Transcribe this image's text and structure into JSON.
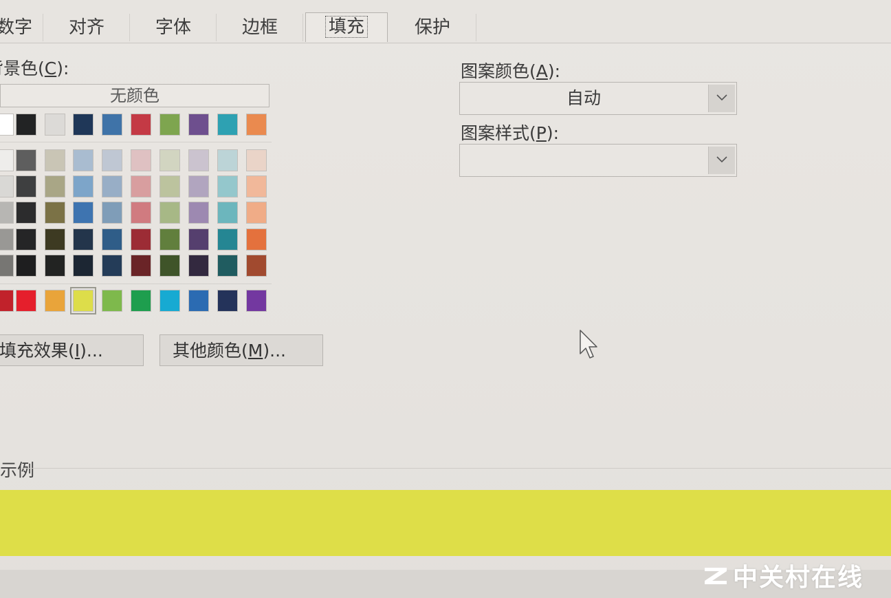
{
  "tabs": [
    {
      "label": "数字"
    },
    {
      "label": "对齐"
    },
    {
      "label": "字体"
    },
    {
      "label": "边框"
    },
    {
      "label": "填充",
      "active": true
    },
    {
      "label": "保护"
    }
  ],
  "background_color": {
    "label_text": "背景色",
    "hotkey": "C",
    "no_color_label": "无颜色"
  },
  "palette": {
    "theme_top_row": [
      "#ffffff",
      "#222324",
      "#dcdad7",
      "#1f3758",
      "#3f73a8",
      "#c43a45",
      "#7ea54f",
      "#6e4f8e",
      "#2ea1b2",
      "#ea8a4f"
    ],
    "theme_tints": [
      [
        "#eeedeb",
        "#5e5e5e",
        "#c9c5b5",
        "#a9bcd0",
        "#bfc7d3",
        "#dfc1c2",
        "#d2d5c1",
        "#cbc3cf",
        "#bcd4d7",
        "#ead4c8"
      ],
      [
        "#d9d8d5",
        "#3e3f40",
        "#a9a686",
        "#7da5c9",
        "#98aec6",
        "#d89e9f",
        "#bcc39e",
        "#b1a5bf",
        "#94c7cc",
        "#f1b89a"
      ],
      [
        "#b7b6b3",
        "#2c2c2d",
        "#7b7246",
        "#3e74b0",
        "#7f9db8",
        "#d07b80",
        "#a7b886",
        "#9d89b1",
        "#6cb6bd",
        "#f0ac87"
      ],
      [
        "#999895",
        "#252526",
        "#3d3a22",
        "#23354b",
        "#2f5d88",
        "#9c2c35",
        "#617f3d",
        "#553f6e",
        "#258693",
        "#e4713d"
      ],
      [
        "#777673",
        "#1e1e1f",
        "#222322",
        "#1c2633",
        "#243c58",
        "#6a2427",
        "#3f5429",
        "#33293f",
        "#205c60",
        "#a14a2f"
      ]
    ],
    "standard_colors": [
      "#c1222b",
      "#e51f2c",
      "#e9a43a",
      "#dddd4a",
      "#7eb94c",
      "#1e9e4e",
      "#17aad2",
      "#2b6bb2",
      "#24335a",
      "#7338a0"
    ],
    "selected_standard_index": 3
  },
  "buttons": {
    "fill_effects": {
      "text": "填充效果",
      "hotkey": "I",
      "suffix": "..."
    },
    "more_colors": {
      "text": "其他颜色",
      "hotkey": "M",
      "suffix": "..."
    }
  },
  "pattern_color": {
    "label_text": "图案颜色",
    "hotkey": "A",
    "value": "自动"
  },
  "pattern_style": {
    "label_text": "图案样式",
    "hotkey": "P",
    "value": ""
  },
  "sample": {
    "label": "示例",
    "fill_color": "#dede48"
  },
  "watermark": {
    "text": "中关村在线"
  }
}
